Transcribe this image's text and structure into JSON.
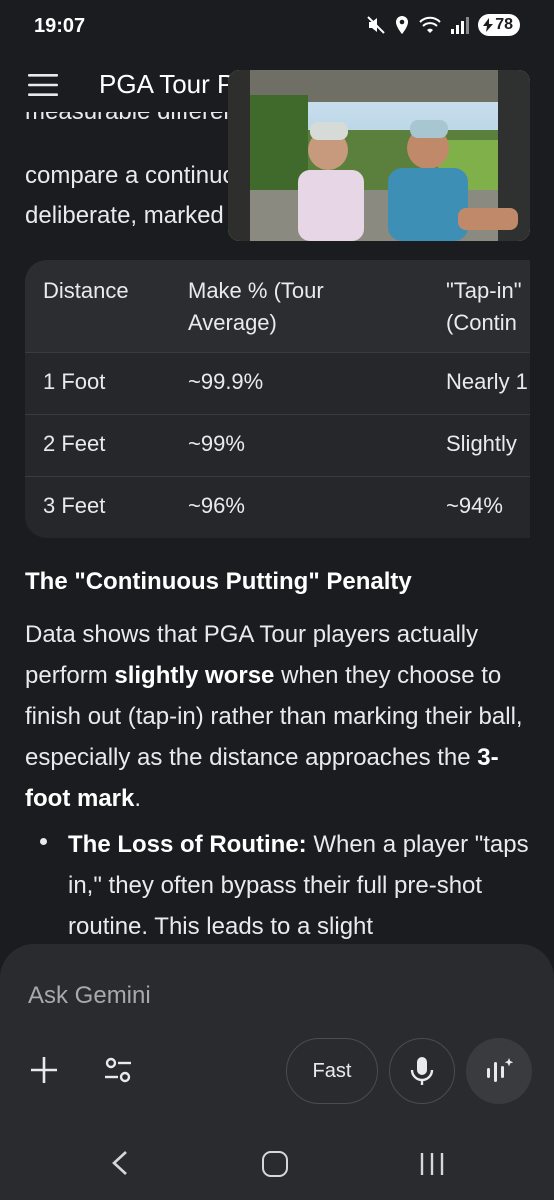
{
  "status_bar": {
    "time": "19:07",
    "battery": "78",
    "icons": [
      "mute-icon",
      "location-icon",
      "wifi-icon",
      "signal-icon",
      "battery-icon"
    ]
  },
  "app_bar": {
    "title": "PGA Tour Putting",
    "menu_icon": "menu-icon"
  },
  "content": {
    "intro_lines": [
      "measurable difference",
      "compare a continuous",
      "deliberate, marked"
    ],
    "table": {
      "headers": [
        "Distance",
        "Make % (Tour\nAverage)",
        "\"Tap-in\"\n(Contin"
      ],
      "rows": [
        [
          "1 Foot",
          "~99.9%",
          "Nearly 1"
        ],
        [
          "2 Feet",
          "~99%",
          "Slightly"
        ],
        [
          "3 Feet",
          "~96%",
          "~94%"
        ]
      ]
    },
    "section_heading": "The \"Continuous Putting\" Penalty",
    "paragraph": {
      "part1": "Data shows that PGA Tour players actually perform ",
      "bold1": "slightly worse",
      "part2": " when they choose to finish out (tap-in) rather than marking their ball, especially as the distance approaches the ",
      "bold2": "3-foot mark",
      "part3": "."
    },
    "bullet": {
      "bold": "The Loss of Routine:",
      "text": " When a player \"taps in,\" they often bypass their full pre-shot routine. This leads to a slight"
    }
  },
  "video_pip": {
    "description_icon": "video-thumbnail"
  },
  "composer": {
    "placeholder": "Ask Gemini",
    "fast_label": "Fast"
  },
  "colors": {
    "background": "#1b1c1f",
    "table_bg": "#26272b",
    "composer_bg": "#2a2b2f",
    "text": "#e8eaed"
  }
}
